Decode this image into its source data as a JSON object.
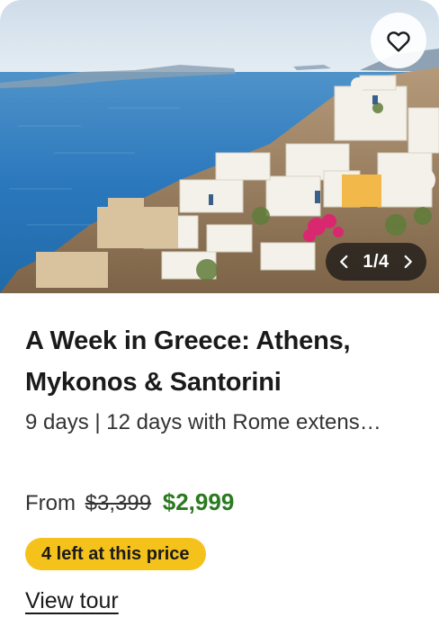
{
  "card": {
    "image": {
      "alt_subject": "Santorini whitewashed village above the sea",
      "colors": {
        "sea": "#2f7fc2",
        "sky": "#dbe8f2",
        "buildings": "#f4f1ea"
      }
    },
    "favorite": {
      "icon": "heart-icon"
    },
    "carousel": {
      "prev_icon": "chevron-left-icon",
      "next_icon": "chevron-right-icon",
      "counter": "1/4"
    },
    "title": "A Week in Greece: Athens, Mykonos & Santorini",
    "duration": "9 days | 12 days with Rome extens…",
    "price": {
      "from_label": "From",
      "original": "$3,399",
      "current": "$2,999"
    },
    "badge": "4 left at this price",
    "link": "View tour"
  },
  "colors": {
    "price_green": "#2a7a1f",
    "badge_yellow": "#f5c21b"
  }
}
